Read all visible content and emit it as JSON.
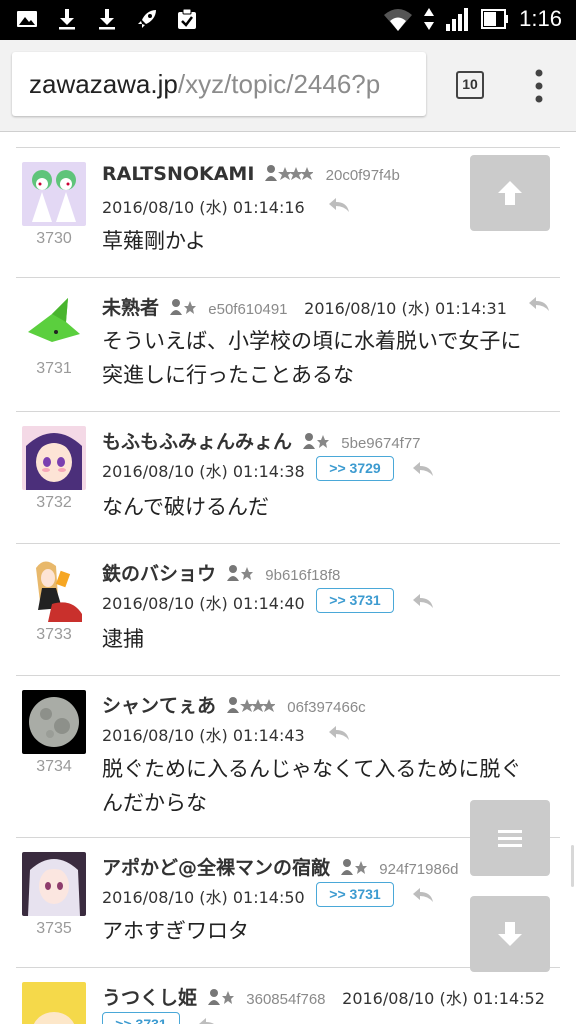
{
  "status_bar": {
    "time": "1:16",
    "left_icons": [
      "gallery-icon",
      "download-icon",
      "download-icon",
      "rocket-icon",
      "clipboard-check-icon"
    ],
    "right_icons": [
      "wifi-icon",
      "data-arrows-icon",
      "signal-icon",
      "battery-icon"
    ]
  },
  "browser": {
    "url_host": "zawazawa.jp",
    "url_path": "/xyz/topic/2446?p",
    "tab_count": "10"
  },
  "posts": [
    {
      "num": "3730",
      "name": "RALTSNOKAMI",
      "stars": 3,
      "uid": "20c0f97f4b",
      "timestamp": "2016/08/10 (水) 01:14:16",
      "reply_to": "",
      "lines": [
        "草薙剛かよ"
      ]
    },
    {
      "num": "3731",
      "name": "未熟者",
      "stars": 1,
      "uid": "e50f610491",
      "timestamp": "2016/08/10 (水) 01:14:31",
      "reply_to": "",
      "lines": [
        "そういえば、小学校の頃に水着脱いで女子に",
        "突進しに行ったことあるな"
      ]
    },
    {
      "num": "3732",
      "name": "もふもふみょんみょん",
      "stars": 1,
      "uid": "5be9674f77",
      "timestamp": "2016/08/10 (水) 01:14:38",
      "reply_to": ">> 3729",
      "lines": [
        "なんで破けるんだ"
      ]
    },
    {
      "num": "3733",
      "name": "鉄のバショウ",
      "stars": 1,
      "uid": "9b616f18f8",
      "timestamp": "2016/08/10 (水) 01:14:40",
      "reply_to": ">> 3731",
      "lines": [
        "逮捕"
      ]
    },
    {
      "num": "3734",
      "name": "シャンてぇあ",
      "stars": 3,
      "uid": "06f397466c",
      "timestamp": "2016/08/10 (水) 01:14:43",
      "reply_to": "",
      "lines": [
        "脱ぐために入るんじゃなくて入るために脱ぐ",
        "んだからな"
      ]
    },
    {
      "num": "3735",
      "name": "アポかど@全裸マンの宿敵",
      "stars": 1,
      "uid": "924f71986d",
      "timestamp": "2016/08/10 (水) 01:14:50",
      "reply_to": ">> 3731",
      "lines": [
        "アホすぎワロタ"
      ]
    },
    {
      "num": "",
      "name": "うつくし姫",
      "stars": 1,
      "uid": "360854f768",
      "timestamp": "2016/08/10 (水) 01:14:52",
      "reply_to": ">> 3731",
      "lines": []
    }
  ],
  "floating": {
    "scroll_up_icon": "arrow-up-icon",
    "menu_icon": "hamburger-icon",
    "scroll_down_icon": "arrow-down-icon"
  },
  "colors": {
    "reply_badge": "#4aa8d8",
    "fab": "#cbcbcb",
    "status_bar": "#000000"
  }
}
